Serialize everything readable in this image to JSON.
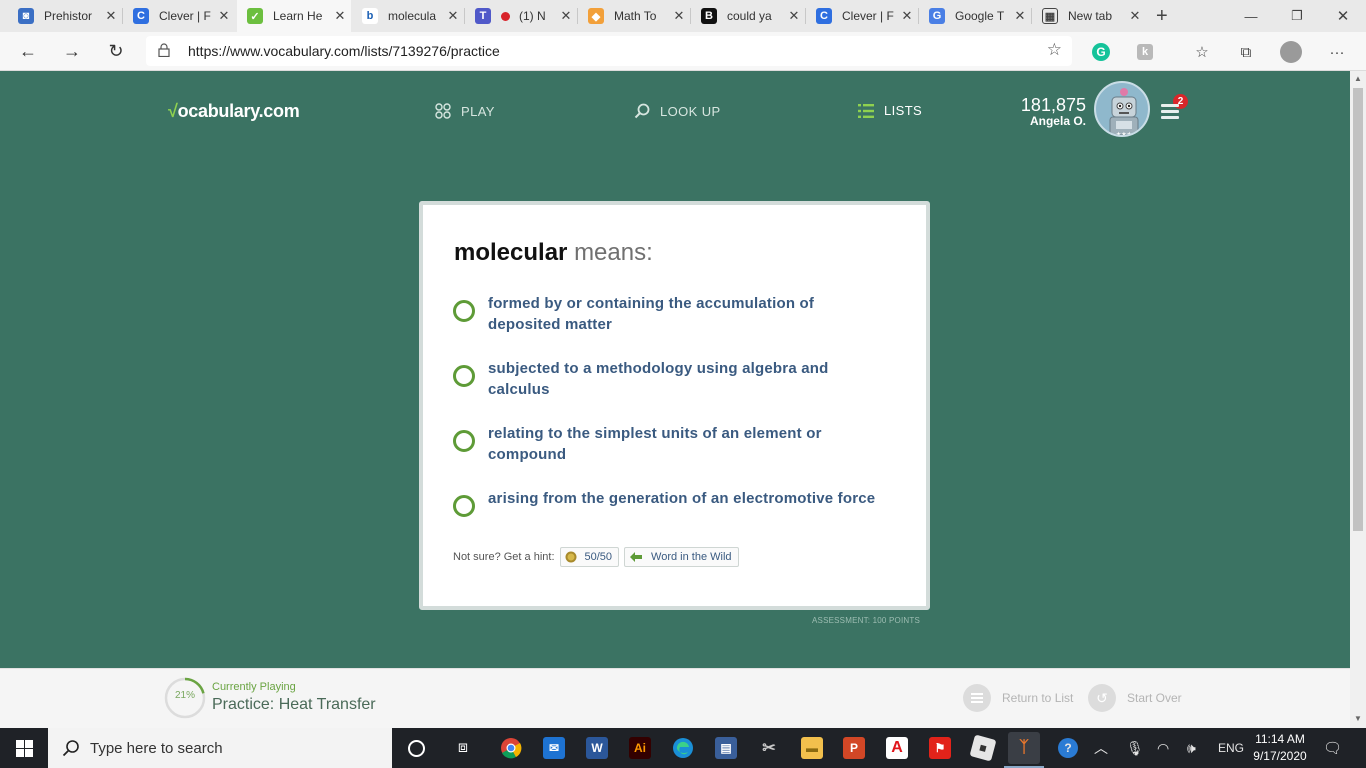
{
  "browser": {
    "tabs": [
      {
        "title": "Prehistor",
        "favicon_color": "#3b6fc4",
        "favicon_glyph": "◙"
      },
      {
        "title": "Clever | F",
        "favicon_color": "#2f6fe0",
        "favicon_glyph": "C"
      },
      {
        "title": "Learn He",
        "favicon_color": "#6cbf3f",
        "favicon_glyph": "✓",
        "active": true
      },
      {
        "title": "molecula",
        "favicon_color": "#ffffff",
        "favicon_glyph": "b"
      },
      {
        "title": "(1) N",
        "favicon_color": "#5059c9",
        "favicon_glyph": "T"
      },
      {
        "title": "Math To",
        "favicon_color": "#f2a03a",
        "favicon_glyph": "◆"
      },
      {
        "title": "could ya",
        "favicon_color": "#111111",
        "favicon_glyph": "B"
      },
      {
        "title": "Clever | F",
        "favicon_color": "#2f6fe0",
        "favicon_glyph": "C"
      },
      {
        "title": "Google T",
        "favicon_color": "#4a7fe5",
        "favicon_glyph": "G"
      },
      {
        "title": "New tab",
        "favicon_color": "#555555",
        "favicon_glyph": "▦"
      }
    ],
    "new_tab_label": "+",
    "url": "https://www.vocabulary.com/lists/7139276/practice"
  },
  "site": {
    "logo_check": "√",
    "logo_text": "ocabulary.com",
    "nav": {
      "play": "PLAY",
      "lookup": "LOOK UP",
      "lists": "LISTS"
    },
    "points": "181,875",
    "user": "Angela O.",
    "notifications": "2"
  },
  "question": {
    "word": "molecular",
    "means": "means:",
    "choices": [
      "formed by or containing the accumulation of deposited matter",
      "subjected to a methodology using algebra and calculus",
      "relating to the simplest units of an element or compound",
      "arising from the generation of an electromotive force"
    ],
    "hint_label": "Not sure? Get a hint:",
    "hint_5050": "50/50",
    "hint_wild": "Word in the Wild",
    "assessment": "ASSESSMENT: 100 POINTS"
  },
  "bottom": {
    "progress_pct": "21%",
    "progress_fraction": 0.21,
    "currently_playing": "Currently Playing",
    "title": "Practice: Heat Transfer",
    "return_label": "Return to List",
    "start_over_label": "Start Over"
  },
  "taskbar": {
    "search_placeholder": "Type here to search",
    "lang": "ENG",
    "time": "11:14 AM",
    "date": "9/17/2020"
  },
  "colors": {
    "page_bg": "#3b7363",
    "accent_green": "#5e9b37",
    "choice_text": "#3a5a80"
  }
}
